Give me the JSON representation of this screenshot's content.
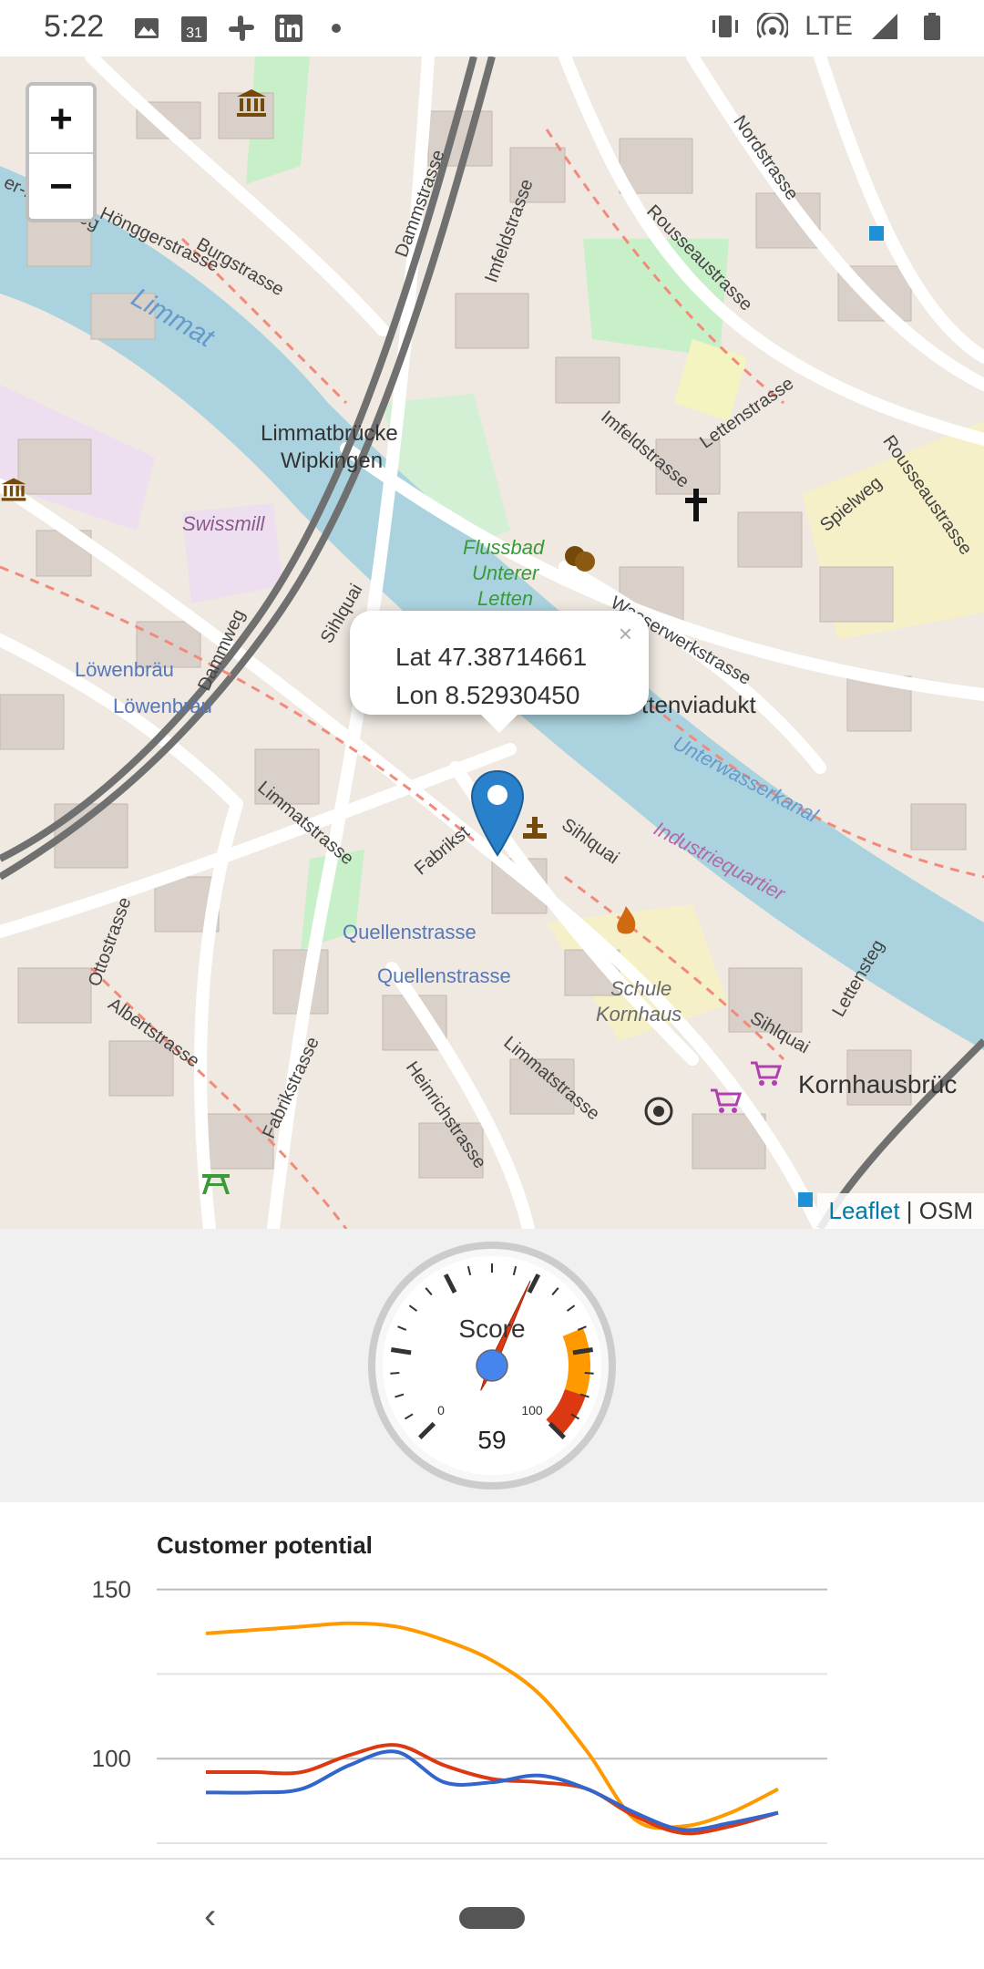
{
  "status_bar": {
    "time": "5:22",
    "left_icons": [
      "image-icon",
      "calendar-icon",
      "slack-icon",
      "linkedin-icon",
      "dot-icon"
    ],
    "calendar_day": "31",
    "network": "LTE",
    "right_icons": [
      "vibrate-icon",
      "hotspot-icon",
      "signal-icon",
      "battery-icon"
    ]
  },
  "map": {
    "zoom_in_label": "+",
    "zoom_out_label": "−",
    "popup": {
      "lat_text": "Lat 47.38714661",
      "lon_text": "Lon 8.52930450",
      "close_label": "×"
    },
    "attribution": {
      "leaflet": "Leaflet",
      "separator": " | ",
      "osm": "OSM"
    },
    "labels": {
      "limmat": "Limmat",
      "limmatbrucke": "Limmatbrücke",
      "wipkingen": "Wipkingen",
      "swissmill": "Swissmill",
      "flussbad1": "Flussbad",
      "flussbad2": "Unterer",
      "flussbad3": "Letten",
      "lowenbrau1": "Löwenbräu",
      "lowenbrau2": "Löwenbräu",
      "quellen1": "Quellenstrasse",
      "quellen2": "Quellenstrasse",
      "schule1": "Schule",
      "schule2": "Kornhaus",
      "kornhaus": "Kornhausbrüc",
      "viadukt": "ttenviadukt",
      "unterwasser": "Unterwasserkanal",
      "industrie": "Industriequartier",
      "nordstrasse": "Nordstrasse",
      "rousseau": "Rousseaustrasse",
      "imfeld": "Imfeldstrasse",
      "imfeld2": "Imfeldstrasse",
      "letten": "Lettenstrasse",
      "wasserwerk": "Wasserwerkstrasse",
      "hongger": "Hönggerstrasse",
      "burg": "Burgstrasse",
      "damm": "Dammstrasse",
      "dammweg": "Dammweg",
      "sihlquai": "Sihlquai",
      "sihlquai2": "Sihlquai",
      "sihlquai3": "Sihlquai",
      "limmatstrasse": "Limmatstrasse",
      "limmatstrasse2": "Limmatstrasse",
      "fabrik": "Fabrikst",
      "fabrik2": "Fabrikstrasse",
      "ottostrasse": "Ottostrasse",
      "albert": "Albertstrasse",
      "heinrich": "Heinrichstrasse",
      "spielweg": "Spielweg",
      "lettensteg": "Lettensteg",
      "fahrweg": "er-Fahr-Weg",
      "rousseau2": "Rousseaustrasse"
    }
  },
  "gauge": {
    "label": "Score",
    "value": 59,
    "value_text": "59",
    "min_label": "0",
    "max_label": "100",
    "min": 0,
    "max": 100,
    "colors": {
      "yellow_band": "#ff9900",
      "red_band": "#dc3912",
      "needle": "#dc3912",
      "hub": "#4684ee"
    }
  },
  "chart_data": {
    "type": "line",
    "title": "Customer potential",
    "ylim": [
      75,
      150
    ],
    "yticks": [
      100,
      150
    ],
    "ytick_labels": [
      "100",
      "150"
    ],
    "x": [
      0,
      1,
      2,
      3,
      4,
      5,
      6,
      7,
      8,
      9,
      10,
      11,
      12
    ],
    "series": [
      {
        "color": "#ff9900",
        "values": [
          137,
          138,
          139,
          140,
          139,
          135,
          129,
          119,
          102,
          82,
          80,
          84,
          91
        ]
      },
      {
        "color": "#dc3912",
        "values": [
          96,
          96,
          96,
          101,
          104,
          98,
          94,
          93,
          91,
          83,
          78,
          80,
          84
        ]
      },
      {
        "color": "#3366cc",
        "values": [
          90,
          90,
          91,
          98,
          102,
          93,
          93,
          95,
          91,
          84,
          79,
          81,
          84
        ]
      }
    ]
  },
  "nav": {
    "back_label": "‹"
  }
}
